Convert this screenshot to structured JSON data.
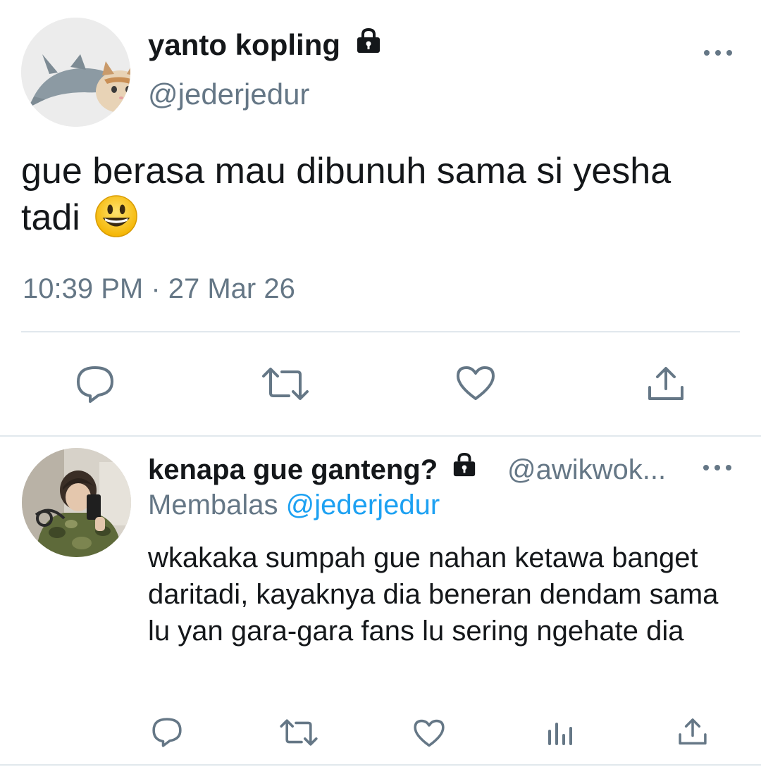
{
  "main_tweet": {
    "display_name": "yanto kopling",
    "handle": "@jederjedur",
    "text": "gue berasa mau dibunuh sama si yesha tadi",
    "emoji": "grinning-face",
    "timestamp": "10:39 PM · 27 Mar 26",
    "protected": true,
    "actions": [
      "reply-icon",
      "retweet-icon",
      "like-icon",
      "share-icon"
    ]
  },
  "reply_tweet": {
    "display_name": "kenapa gue ganteng?",
    "handle": "@awikwok...",
    "replying_prefix": "Membalas",
    "replying_to": "@jederjedur",
    "text": "wkakaka sumpah gue nahan ketawa banget daritadi, kayaknya dia beneran dendam sama lu yan gara-gara fans lu sering ngehate dia",
    "protected": true,
    "actions": [
      "reply-icon",
      "retweet-icon",
      "like-icon",
      "analytics-icon",
      "share-icon"
    ]
  },
  "colors": {
    "text_primary": "#14171a",
    "text_secondary": "#657786",
    "link": "#1da1f2",
    "divider": "#e1e8ed"
  }
}
